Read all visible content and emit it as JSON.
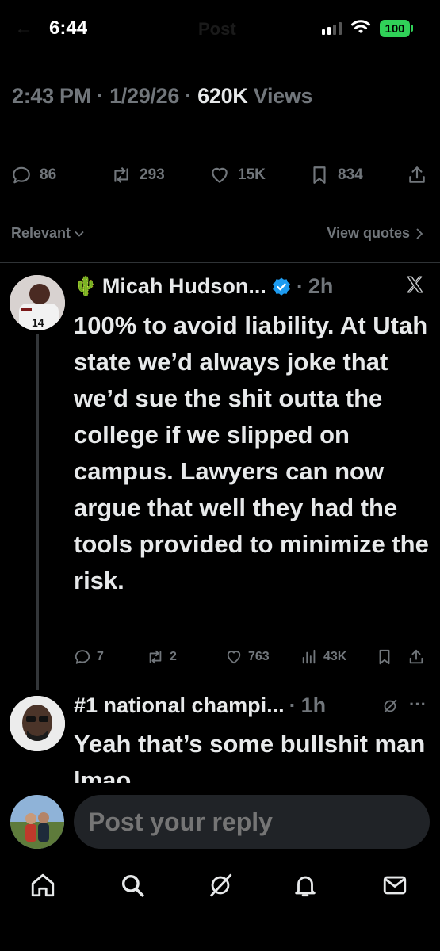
{
  "status": {
    "time": "6:44",
    "battery": "100"
  },
  "header": {
    "title": "Post"
  },
  "post_meta": {
    "time": "2:43 PM",
    "date": "1/29/26",
    "views": "620K",
    "views_label": "Views"
  },
  "post_actions": {
    "replies": "86",
    "reposts": "293",
    "likes": "15K",
    "bookmarks": "834"
  },
  "filter": {
    "label": "Relevant",
    "view_quotes": "View quotes"
  },
  "reply1": {
    "emoji": "🌵",
    "name": "Micah Hudson...",
    "time": "2h",
    "text": "100% to avoid liability. At Utah state we’d always joke that we’d sue the shit outta the college if we slipped on campus. Lawyers can now argue that well they had the tools provided to minimize the risk.",
    "replies": "7",
    "reposts": "2",
    "likes": "763",
    "views": "43K"
  },
  "reply2": {
    "name": "#1 national champi...",
    "time": "1h",
    "text": "Yeah that’s some bullshit man lmao"
  },
  "composer": {
    "placeholder": "Post your reply"
  },
  "colors": {
    "background": "#000000",
    "text": "#e7e9ea",
    "muted": "#71767b",
    "verified": "#1d9bf0",
    "battery": "#30d158"
  },
  "icons": [
    "home-icon",
    "search-icon",
    "grok-icon",
    "notifications-icon",
    "messages-icon"
  ]
}
